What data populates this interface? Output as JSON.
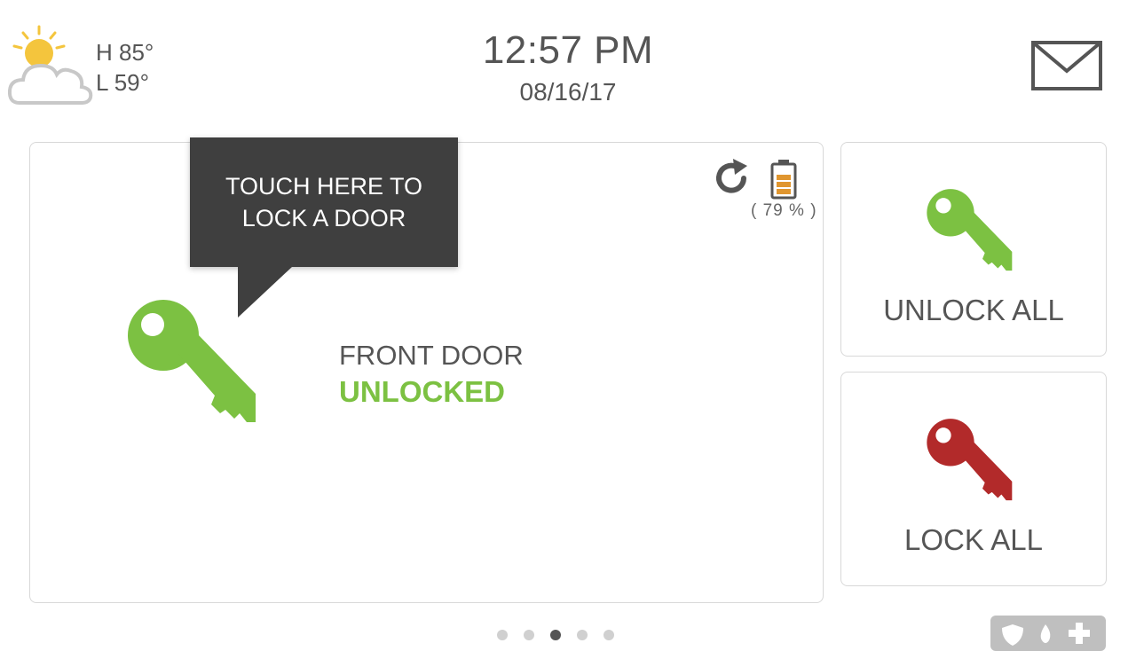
{
  "weather": {
    "icon": "partly-cloudy-icon",
    "high": "H 85°",
    "low": "L 59°"
  },
  "clock": {
    "time": "12:57 PM",
    "date": "08/16/17"
  },
  "messages": {
    "icon": "envelope-icon"
  },
  "lock_device": {
    "name": "FRONT DOOR",
    "status": "UNLOCKED",
    "status_color": "#7cc142",
    "battery_text": "( 79 % )",
    "battery_level": 0.79,
    "tooltip": "TOUCH HERE TO LOCK A DOOR"
  },
  "actions": {
    "unlock_all": "UNLOCK ALL",
    "lock_all": "LOCK ALL"
  },
  "colors": {
    "unlocked_key": "#7cc142",
    "locked_key": "#b22a2a",
    "tooltip_bg": "#3f3f3f"
  },
  "pagination": {
    "total": 5,
    "active": 3
  }
}
